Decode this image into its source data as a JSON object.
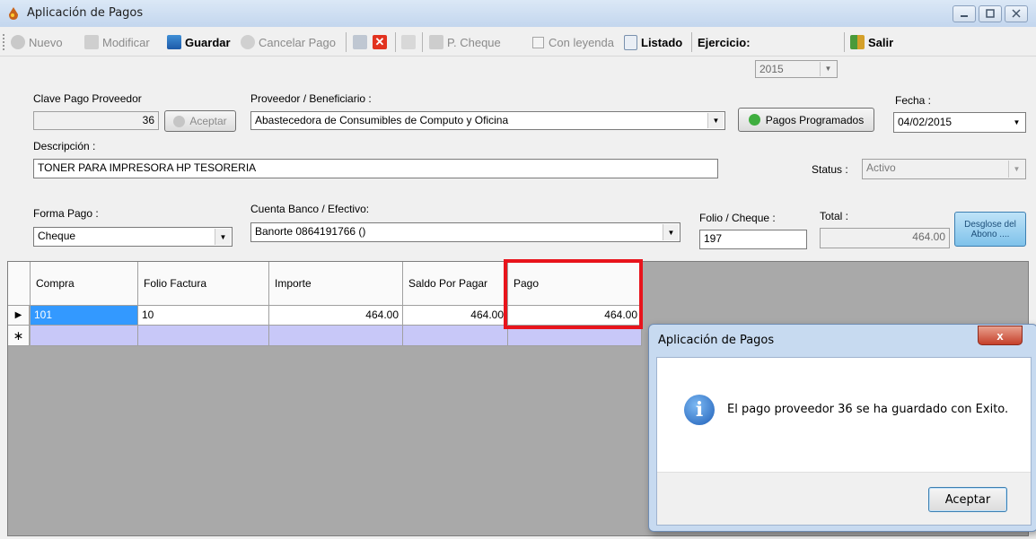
{
  "window": {
    "title": "Aplicación de Pagos"
  },
  "toolbar": {
    "nuevo": "Nuevo",
    "modificar": "Modificar",
    "guardar": "Guardar",
    "cancelar_pago": "Cancelar Pago",
    "p_cheque": "P. Cheque",
    "con_leyenda": "Con leyenda",
    "listado": "Listado",
    "ejercicio_label": "Ejercicio:",
    "ejercicio_value": "2015",
    "salir": "Salir"
  },
  "form": {
    "clave_label": "Clave Pago Proveedor",
    "clave_value": "36",
    "aceptar_btn": "Aceptar",
    "proveedor_label": "Proveedor / Beneficiario :",
    "proveedor_value": "Abastecedora  de Consumibles de Computo y Oficina",
    "pagos_programados_btn": "Pagos Programados",
    "fecha_label": "Fecha :",
    "fecha_value": "04/02/2015",
    "descripcion_label": "Descripción :",
    "descripcion_value": "TONER PARA IMPRESORA HP TESORERIA",
    "status_label": "Status :",
    "status_value": "Activo",
    "forma_pago_label": "Forma Pago :",
    "forma_pago_value": "Cheque",
    "cuenta_label": "Cuenta Banco / Efectivo:",
    "cuenta_value": "Banorte 0864191766 ()",
    "folio_label": "Folio / Cheque :",
    "folio_value": "197",
    "total_label": "Total :",
    "total_value": "464.00",
    "desglose_btn": "Desglose del Abono ...."
  },
  "grid": {
    "columns": [
      "Compra",
      "Folio Factura",
      "Importe",
      "Saldo Por Pagar",
      "Pago"
    ],
    "rows": [
      {
        "compra": "101",
        "folio_factura": "10",
        "importe": "464.00",
        "saldo": "464.00",
        "pago": "464.00"
      }
    ],
    "highlight_color": "#e8141c"
  },
  "dialog": {
    "title": "Aplicación de Pagos",
    "message": "El pago proveedor 36 se ha guardado con Exito.",
    "ok_button": "Aceptar",
    "close_glyph": "x"
  }
}
